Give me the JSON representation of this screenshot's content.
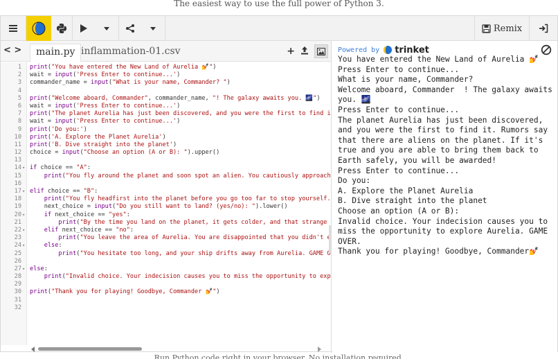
{
  "page": {
    "top_caption": "The easiest way to use the full power of Python 3.",
    "bottom_caption": "Run Python code right in your browser. No installation required."
  },
  "toolbar": {
    "remix_label": "Remix"
  },
  "editor": {
    "tabs": [
      {
        "label": "main.py",
        "active": true
      },
      {
        "label": "inflammation-01.csv",
        "active": false
      }
    ],
    "lines": [
      {
        "n": "1",
        "fold": false,
        "html": "<span class='k'>print</span>(<span class='s'>\"You have entered the New Land of Aurelia 💅\"</span>)"
      },
      {
        "n": "2",
        "fold": false,
        "html": "wait = <span class='k'>input</span>(<span class='s'>'Press Enter to continue...'</span>)"
      },
      {
        "n": "3",
        "fold": false,
        "html": "commander_name = <span class='k'>input</span>(<span class='s'>\"What is your name, Commander? \"</span>)"
      },
      {
        "n": "4",
        "fold": false,
        "html": ""
      },
      {
        "n": "5",
        "fold": false,
        "html": "<span class='k'>print</span>(<span class='s'>\"Welcome aboard, Commander\"</span>, commander_name, <span class='s'>\"! The galaxy awaits you. 🌌\"</span>)"
      },
      {
        "n": "6",
        "fold": false,
        "html": "wait = <span class='k'>input</span>(<span class='s'>'Press Enter to continue...'</span>)"
      },
      {
        "n": "7",
        "fold": false,
        "html": "<span class='k'>print</span>(<span class='s'>\"The planet Aurelia has just been discovered, and you were the first to find it.\"</span>)"
      },
      {
        "n": "8",
        "fold": false,
        "html": "wait = <span class='k'>input</span>(<span class='s'>'Press Enter to continue...'</span>)"
      },
      {
        "n": "9",
        "fold": false,
        "html": "<span class='k'>print</span>(<span class='s'>'Do you:'</span>)"
      },
      {
        "n": "10",
        "fold": false,
        "html": "<span class='k'>print</span>(<span class='s'>'A. Explore the Planet Aurelia'</span>)"
      },
      {
        "n": "11",
        "fold": false,
        "html": "<span class='k'>print</span>(<span class='s'>'B. Dive straight into the planet'</span>)"
      },
      {
        "n": "12",
        "fold": false,
        "html": "choice = <span class='k'>input</span>(<span class='s'>\"Choose an option (A or B): \"</span>).upper()"
      },
      {
        "n": "13",
        "fold": false,
        "html": ""
      },
      {
        "n": "14",
        "fold": true,
        "html": "<span class='k'>if</span> choice == <span class='s'>\"A\"</span>:"
      },
      {
        "n": "15",
        "fold": false,
        "html": "    <span class='k'>print</span>(<span class='s'>\"You fly around the planet and soon spot an alien. You cautiously approach it.\"</span>)"
      },
      {
        "n": "16",
        "fold": false,
        "html": ""
      },
      {
        "n": "17",
        "fold": true,
        "html": "<span class='k'>elif</span> choice == <span class='s'>\"B\"</span>:"
      },
      {
        "n": "18",
        "fold": false,
        "html": "    <span class='k'>print</span>(<span class='s'>\"You fly headfirst into the planet before you go too far to stop yourself.\"</span>)"
      },
      {
        "n": "19",
        "fold": false,
        "html": "    next_choice = <span class='k'>input</span>(<span class='s'>\"Do you still want to land? (yes/no): \"</span>).lower()"
      },
      {
        "n": "20",
        "fold": true,
        "html": "    <span class='k'>if</span> next_choice == <span class='s'>\"yes\"</span>:"
      },
      {
        "n": "21",
        "fold": false,
        "html": "        <span class='k'>print</span>(<span class='s'>\"By the time you land on the planet, it gets colder, and that strange feeling grows.\"</span>)"
      },
      {
        "n": "22",
        "fold": true,
        "html": "    <span class='k'>elif</span> next_choice == <span class='s'>\"no\"</span>:"
      },
      {
        "n": "23",
        "fold": false,
        "html": "        <span class='k'>print</span>(<span class='s'>\"You leave the area of Aurelia. You are disappointed that you didn't explore.\"</span>)"
      },
      {
        "n": "24",
        "fold": true,
        "html": "    <span class='k'>else</span>:"
      },
      {
        "n": "25",
        "fold": false,
        "html": "        <span class='k'>print</span>(<span class='s'>\"You hesitate too long, and your ship drifts away from Aurelia. GAME OVER.\"</span>)"
      },
      {
        "n": "26",
        "fold": false,
        "html": ""
      },
      {
        "n": "27",
        "fold": true,
        "html": "<span class='k'>else</span>:"
      },
      {
        "n": "28",
        "fold": false,
        "html": "    <span class='k'>print</span>(<span class='s'>\"Invalid choice. Your indecision causes you to miss the opportunity to explore Aurelia.\"</span>)"
      },
      {
        "n": "29",
        "fold": false,
        "html": ""
      },
      {
        "n": "30",
        "fold": false,
        "html": "<span class='k'>print</span>(<span class='s'>\"Thank you for playing! Goodbye, Commander 💅\"</span>)"
      },
      {
        "n": "31",
        "fold": false,
        "html": ""
      },
      {
        "n": "32",
        "fold": false,
        "html": ""
      }
    ]
  },
  "output": {
    "powered_by": "Powered by",
    "brand": "trinket",
    "console": [
      "You have entered the New Land of Aurelia 💅",
      "Press Enter to continue...",
      "What is your name, Commander?",
      "Welcome aboard, Commander  ! The galaxy awaits you. 🌌",
      "Press Enter to continue...",
      "The planet Aurelia has just been discovered, and you were the first to find it. Rumors say that there are aliens on the planet. If it's true and you are able to bring them back to Earth safely, you will be awarded!",
      "Press Enter to continue...",
      "Do you:",
      "A. Explore the Planet Aurelia",
      "B. Dive straight into the planet",
      "Choose an option (A or B):",
      "Invalid choice. Your indecision causes you to miss the opportunity to explore Aurelia. GAME OVER.",
      "Thank you for playing! Goodbye, Commander💅"
    ]
  },
  "colors": {
    "link_blue": "#3b7dd8",
    "string_red": "#aa1111",
    "keyword_purple": "#770088",
    "logo_yellow": "#f5c518",
    "logo_blue": "#1f6fd1"
  }
}
